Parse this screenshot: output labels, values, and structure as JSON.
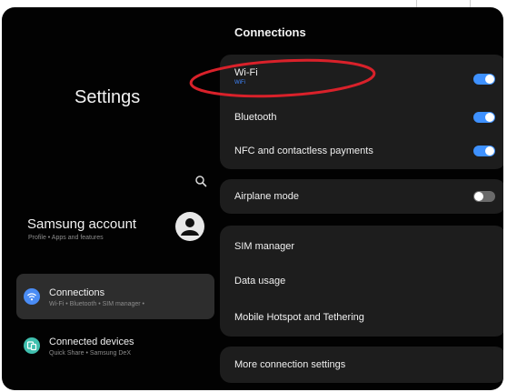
{
  "left": {
    "title": "Settings",
    "account": {
      "name": "Samsung account",
      "subtitle": "Profile  •  Apps and features"
    },
    "menu": [
      {
        "label": "Connections",
        "subtitle": "Wi-Fi  •  Bluetooth  •  SIM manager  •",
        "icon": "wifi-icon",
        "color": "#4a8cf5",
        "selected": true
      },
      {
        "label": "Connected devices",
        "subtitle": "Quick Share  •  Samsung DeX",
        "icon": "connected-devices-icon",
        "color": "#3fbfae",
        "selected": false
      }
    ]
  },
  "right": {
    "header": "Connections",
    "groups": [
      {
        "rows": [
          {
            "label": "Wi-Fi",
            "sub": "WiFi",
            "toggle": "on"
          },
          {
            "label": "Bluetooth",
            "toggle": "on"
          },
          {
            "label": "NFC and contactless payments",
            "toggle": "on"
          }
        ]
      },
      {
        "rows": [
          {
            "label": "Airplane mode",
            "toggle": "off"
          }
        ]
      },
      {
        "rows": [
          {
            "label": "SIM manager"
          },
          {
            "label": "Data usage"
          },
          {
            "label": "Mobile Hotspot and Tethering"
          }
        ]
      },
      {
        "rows": [
          {
            "label": "More connection settings"
          }
        ]
      }
    ]
  },
  "colors": {
    "accent": "#3e91ff",
    "annotation": "#d9212a",
    "screen_bg": "#020202",
    "card_bg": "#1d1d1d"
  }
}
